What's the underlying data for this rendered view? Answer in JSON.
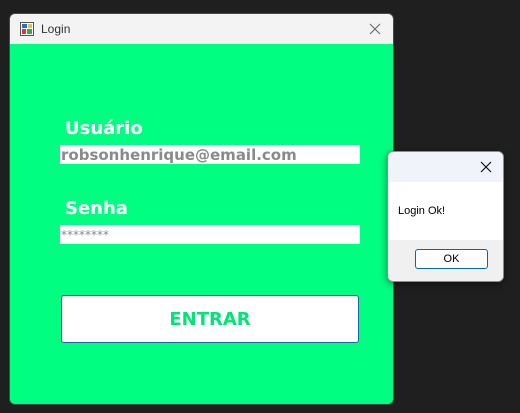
{
  "window": {
    "title": "Login",
    "icon": "form-app-icon",
    "close_icon": "close-icon",
    "background_color": "#00ff80"
  },
  "form": {
    "user_label": "Usuário",
    "user_value": "robsonhenrique@email.com",
    "password_label": "Senha",
    "password_value": "********",
    "submit_label": "ENTRAR",
    "submit_text_color": "#00e676"
  },
  "dialog": {
    "message": "Login Ok!",
    "ok_label": "OK",
    "close_icon": "close-icon",
    "accent_color": "#0067c0"
  }
}
